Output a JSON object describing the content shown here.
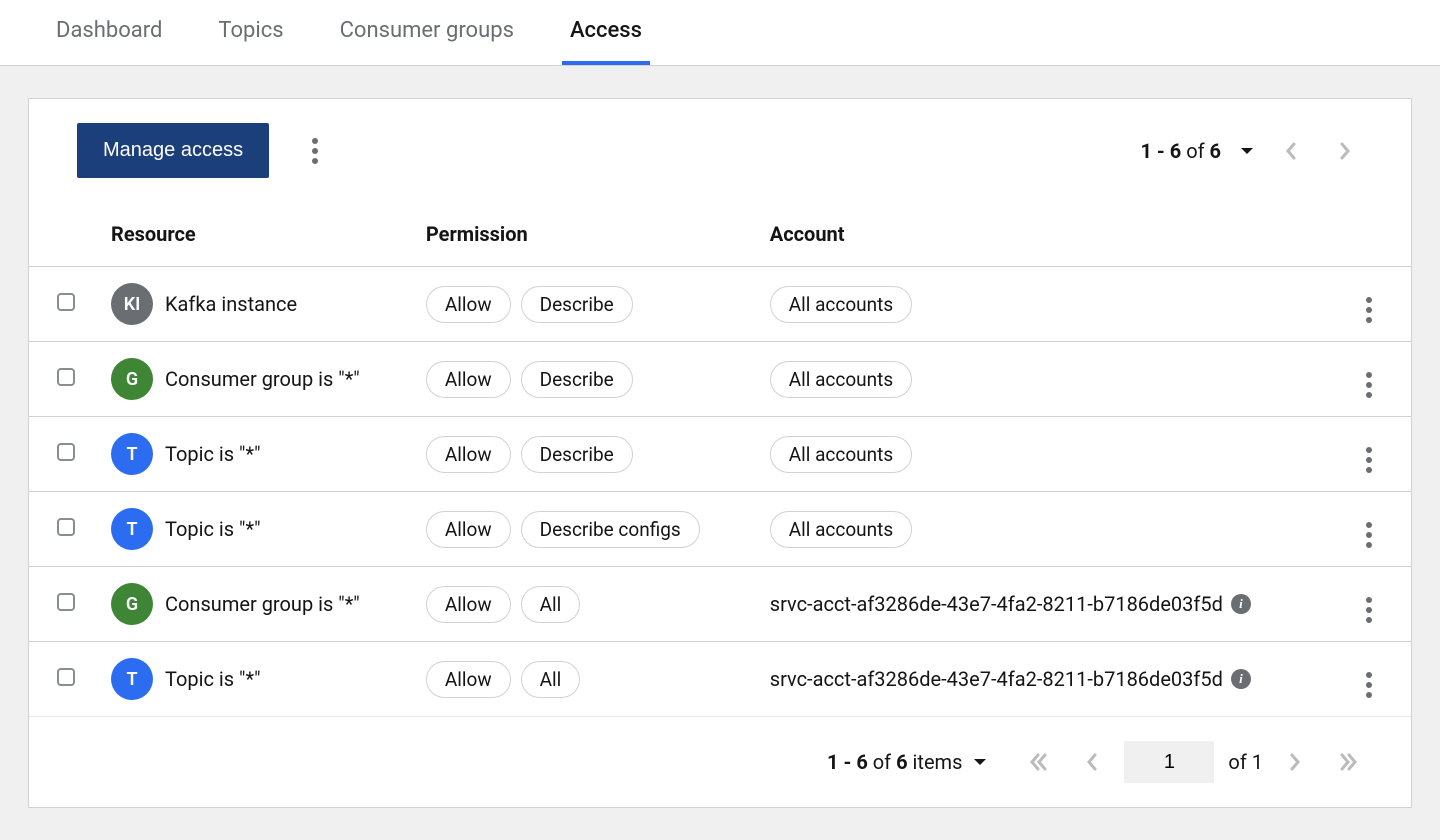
{
  "tabs": [
    {
      "label": "Dashboard",
      "active": false
    },
    {
      "label": "Topics",
      "active": false
    },
    {
      "label": "Consumer groups",
      "active": false
    },
    {
      "label": "Access",
      "active": true
    }
  ],
  "toolbar": {
    "manage_label": "Manage access"
  },
  "pagination_top": {
    "range": "1 - 6",
    "of_word": "of",
    "total": "6"
  },
  "columns": {
    "resource": "Resource",
    "permission": "Permission",
    "account": "Account"
  },
  "rows": [
    {
      "icon": "KI",
      "icon_color": "gray",
      "resource": "Kafka instance",
      "perms": [
        "Allow",
        "Describe"
      ],
      "account": "All accounts",
      "account_chip": true,
      "info": false
    },
    {
      "icon": "G",
      "icon_color": "green",
      "resource": "Consumer group is \"*\"",
      "perms": [
        "Allow",
        "Describe"
      ],
      "account": "All accounts",
      "account_chip": true,
      "info": false
    },
    {
      "icon": "T",
      "icon_color": "blue",
      "resource": "Topic is \"*\"",
      "perms": [
        "Allow",
        "Describe"
      ],
      "account": "All accounts",
      "account_chip": true,
      "info": false
    },
    {
      "icon": "T",
      "icon_color": "blue",
      "resource": "Topic is \"*\"",
      "perms": [
        "Allow",
        "Describe configs"
      ],
      "account": "All accounts",
      "account_chip": true,
      "info": false
    },
    {
      "icon": "G",
      "icon_color": "green",
      "resource": "Consumer group is \"*\"",
      "perms": [
        "Allow",
        "All"
      ],
      "account": "srvc-acct-af3286de-43e7-4fa2-8211-b7186de03f5d",
      "account_chip": false,
      "info": true
    },
    {
      "icon": "T",
      "icon_color": "blue",
      "resource": "Topic is \"*\"",
      "perms": [
        "Allow",
        "All"
      ],
      "account": "srvc-acct-af3286de-43e7-4fa2-8211-b7186de03f5d",
      "account_chip": false,
      "info": true
    }
  ],
  "pagination_bottom": {
    "range": "1 - 6",
    "of_word": "of",
    "total": "6",
    "items_word": "items",
    "page_input": "1",
    "of_pages_word": "of",
    "total_pages": "1"
  }
}
